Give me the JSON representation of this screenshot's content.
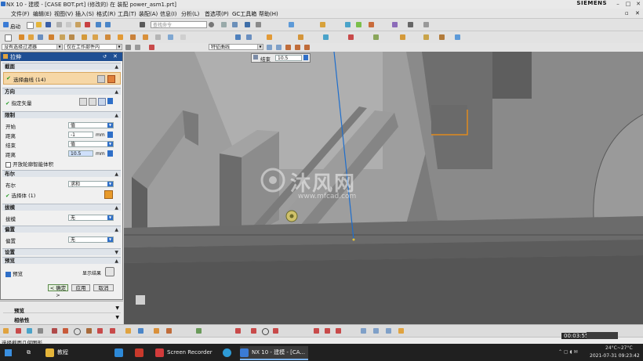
{
  "window": {
    "title": "NX 10 - 建模 - [CASE BOT.prt]  (修改的)   在 装配 power_asm1.prt]",
    "brand": "SIEMENS"
  },
  "menubar": {
    "items": [
      "文件(F)",
      "编辑(E)",
      "视图(V)",
      "插入(S)",
      "格式(R)",
      "工具(T)",
      "装配(A)",
      "信息(I)",
      "分析(L)",
      "首选项(P)",
      "GC工具箱",
      "帮助(H)"
    ]
  },
  "toolbar": {
    "start_label": "启动",
    "search_placeholder": "查找命令"
  },
  "selection_bar": {
    "filter": "没有选择过滤器",
    "scope": "仅在工作部件内",
    "curve_rule": "特征曲线"
  },
  "floating_input": {
    "label": "结束",
    "value": "10.5"
  },
  "dialog": {
    "title": "拉伸",
    "sections": {
      "section_curve": {
        "title": "截面",
        "select_curve": "选择曲线 (14)"
      },
      "direction": {
        "title": "方向",
        "specify_vector": "指定矢量"
      },
      "limits": {
        "title": "限制",
        "start_label": "开始",
        "start_value": "值",
        "start_distance_label": "距离",
        "start_distance": "-1",
        "start_unit": "mm",
        "end_label": "结束",
        "end_value": "值",
        "end_distance_label": "距离",
        "end_distance": "10.5",
        "end_unit": "mm",
        "open_profile": "开放轮廓智能体积"
      },
      "boolean": {
        "title": "布尔",
        "boolean_label": "布尔",
        "boolean_value": "求和",
        "select_body": "选择体 (1)"
      },
      "draft": {
        "title": "拔模",
        "label": "拔模",
        "value": "无"
      },
      "offset": {
        "title": "偏置",
        "label": "偏置",
        "value": "无"
      },
      "settings": {
        "title": "设置"
      },
      "preview": {
        "title": "预览",
        "preview_label": "预览",
        "show_result": "显示结果"
      }
    },
    "buttons": {
      "ok": "< 确定 >",
      "apply": "应用",
      "cancel": "取消"
    }
  },
  "lower_panel": {
    "item1": "预览",
    "item2": "相依性"
  },
  "statusbar": {
    "text": "选择截面几何图形"
  },
  "watermark": {
    "text": "沐风网",
    "url": "www.mfcad.com"
  },
  "recording": {
    "time": "00:03:55"
  },
  "taskbar": {
    "apps": [
      {
        "label": "教程",
        "icon": "folder-icon",
        "color": "#e5b53a"
      },
      {
        "label": "",
        "icon": "calculator-icon",
        "color": "#2d89d8"
      },
      {
        "label": "",
        "icon": "ms-project-icon",
        "color": "#c8392b"
      },
      {
        "label": "Screen Recorder",
        "icon": "screen-recorder-icon",
        "color": "#d23b3b"
      },
      {
        "label": "",
        "icon": "edge-icon",
        "color": "#2e9bd6"
      },
      {
        "label": "NX 10 - 建模 - [CA...",
        "icon": "nx-icon",
        "color": "#3a7bd5"
      }
    ],
    "weather": "24°C~27°C",
    "datetime": "2021-07-31 09:23:42"
  },
  "colors": {
    "dialog_header": "#1f4f93",
    "highlight_edge": "#e08a1e",
    "vector_line": "#1e6ecc"
  }
}
